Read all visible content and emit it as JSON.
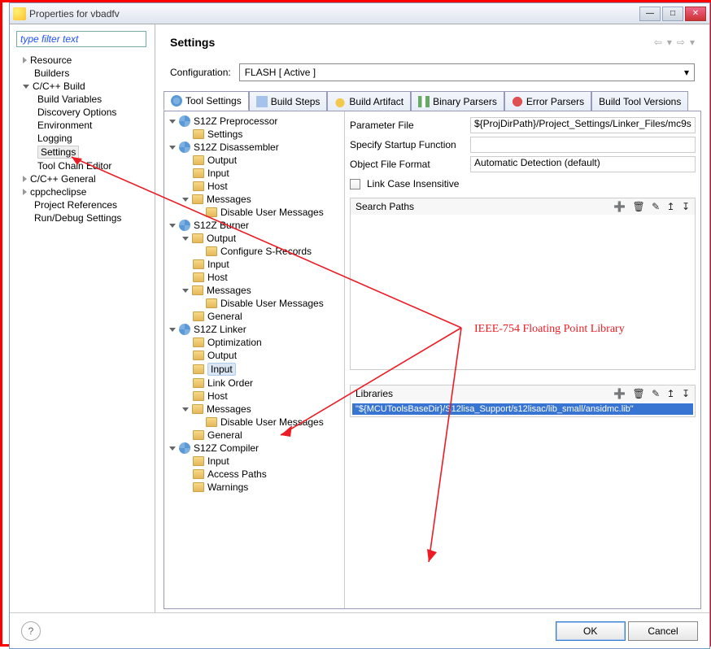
{
  "window": {
    "title": "Properties for vbadfv"
  },
  "header": {
    "title": "Settings",
    "filter_placeholder": "type filter text",
    "config_label": "Configuration:",
    "config_value": "FLASH  [ Active ]"
  },
  "nav": {
    "items": [
      {
        "kind": "node",
        "expand": "col",
        "label": "Resource"
      },
      {
        "kind": "leaf1",
        "label": "Builders"
      },
      {
        "kind": "node",
        "expand": "exp",
        "label": "C/C++ Build"
      },
      {
        "kind": "leaf2",
        "label": "Build Variables"
      },
      {
        "kind": "leaf2",
        "label": "Discovery Options"
      },
      {
        "kind": "leaf2",
        "label": "Environment"
      },
      {
        "kind": "leaf2",
        "label": "Logging"
      },
      {
        "kind": "leaf2",
        "label": "Settings",
        "selected": true
      },
      {
        "kind": "leaf2",
        "label": "Tool Chain Editor"
      },
      {
        "kind": "node",
        "expand": "col",
        "label": "C/C++ General"
      },
      {
        "kind": "node",
        "expand": "col",
        "label": "cppcheclipse"
      },
      {
        "kind": "leaf1",
        "label": "Project References"
      },
      {
        "kind": "leaf1",
        "label": "Run/Debug Settings"
      }
    ]
  },
  "tabs": [
    {
      "icon": "gear",
      "label": "Tool Settings",
      "active": true
    },
    {
      "icon": "steps",
      "label": "Build Steps"
    },
    {
      "icon": "cup",
      "label": "Build Artifact"
    },
    {
      "icon": "bin",
      "label": "Binary Parsers"
    },
    {
      "icon": "err",
      "label": "Error Parsers"
    },
    {
      "icon": "",
      "label": "Build Tool Versions"
    }
  ],
  "settings_tree": [
    {
      "lvl": 0,
      "exp": "exp",
      "icon": "gear",
      "label": "S12Z Preprocessor"
    },
    {
      "lvl": 1,
      "icon": "folder",
      "label": "Settings"
    },
    {
      "lvl": 0,
      "exp": "exp",
      "icon": "gear",
      "label": "S12Z Disassembler"
    },
    {
      "lvl": 1,
      "icon": "folder",
      "label": "Output"
    },
    {
      "lvl": 1,
      "icon": "folder",
      "label": "Input"
    },
    {
      "lvl": 1,
      "icon": "folder",
      "label": "Host"
    },
    {
      "lvl": 1,
      "exp": "exp",
      "icon": "folder",
      "label": "Messages"
    },
    {
      "lvl": 2,
      "icon": "folder",
      "label": "Disable User Messages"
    },
    {
      "lvl": 0,
      "exp": "exp",
      "icon": "gear",
      "label": "S12Z Burner"
    },
    {
      "lvl": 1,
      "exp": "exp",
      "icon": "folder",
      "label": "Output"
    },
    {
      "lvl": 2,
      "icon": "folder",
      "label": "Configure S-Records"
    },
    {
      "lvl": 1,
      "icon": "folder",
      "label": "Input"
    },
    {
      "lvl": 1,
      "icon": "folder",
      "label": "Host"
    },
    {
      "lvl": 1,
      "exp": "exp",
      "icon": "folder",
      "label": "Messages"
    },
    {
      "lvl": 2,
      "icon": "folder",
      "label": "Disable User Messages"
    },
    {
      "lvl": 1,
      "icon": "folder",
      "label": "General"
    },
    {
      "lvl": 0,
      "exp": "exp",
      "icon": "gear",
      "label": "S12Z Linker"
    },
    {
      "lvl": 1,
      "icon": "folder",
      "label": "Optimization"
    },
    {
      "lvl": 1,
      "icon": "folder",
      "label": "Output"
    },
    {
      "lvl": 1,
      "icon": "folder",
      "label": "Input",
      "selected": true
    },
    {
      "lvl": 1,
      "icon": "folder",
      "label": "Link Order"
    },
    {
      "lvl": 1,
      "icon": "folder",
      "label": "Host"
    },
    {
      "lvl": 1,
      "exp": "exp",
      "icon": "folder",
      "label": "Messages"
    },
    {
      "lvl": 2,
      "icon": "folder",
      "label": "Disable User Messages"
    },
    {
      "lvl": 1,
      "icon": "folder",
      "label": "General"
    },
    {
      "lvl": 0,
      "exp": "exp",
      "icon": "gear",
      "label": "S12Z Compiler"
    },
    {
      "lvl": 1,
      "icon": "folder",
      "label": "Input"
    },
    {
      "lvl": 1,
      "icon": "folder",
      "label": "Access Paths"
    },
    {
      "lvl": 1,
      "icon": "folder",
      "label": "Warnings"
    }
  ],
  "props": {
    "param_label": "Parameter File",
    "param_value": "${ProjDirPath}/Project_Settings/Linker_Files/mc9s",
    "startup_label": "Specify Startup Function",
    "startup_value": "",
    "objfmt_label": "Object File Format",
    "objfmt_value": "Automatic Detection (default)",
    "lci_label": "Link Case Insensitive",
    "search_hdr": "Search Paths",
    "lib_hdr": "Libraries",
    "lib_value": "\"${MCUToolsBaseDir}/S12lisa_Support/s12lisac/lib_small/ansidmc.lib\""
  },
  "annotation": {
    "text": "IEEE-754 Floating Point Library"
  },
  "buttons": {
    "ok": "OK",
    "cancel": "Cancel"
  }
}
